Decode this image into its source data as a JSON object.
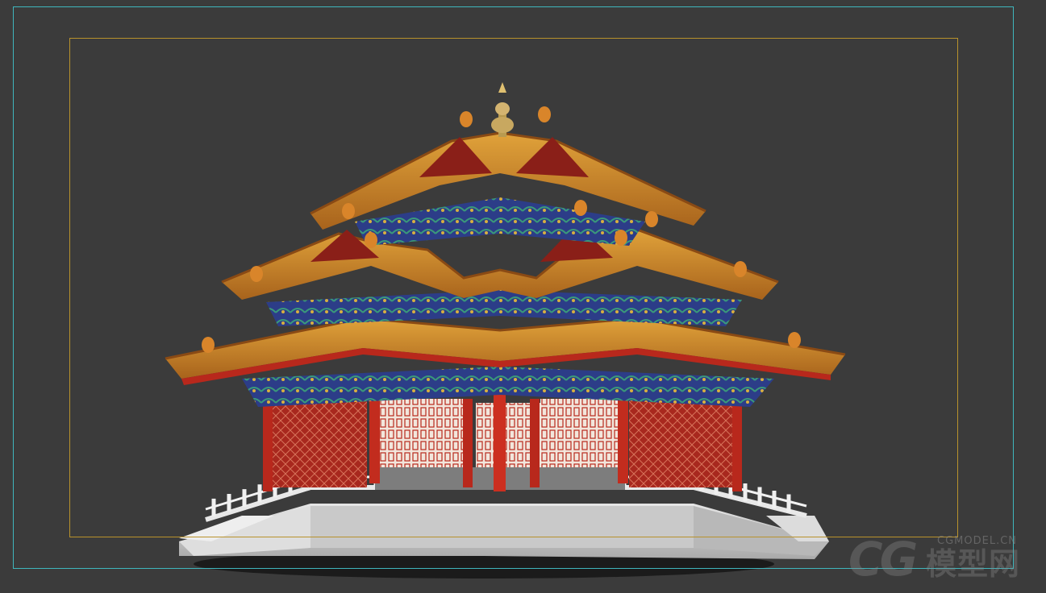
{
  "viewport": {
    "view": "3D viewport render",
    "background_color": "#3b3b3b",
    "safe_frame_color": "#3fb6bd",
    "render_region_color": "#b8922c"
  },
  "scene": {
    "subject": "Chinese palace corner tower model",
    "roof_color": "#c98a2a",
    "column_color": "#b8281c",
    "bracket_color": "#2e3f8a",
    "base_color": "#d8d8d8"
  },
  "watermark": {
    "logo": "CG",
    "site": "CGMODEL.CN",
    "chinese": "模型网"
  }
}
